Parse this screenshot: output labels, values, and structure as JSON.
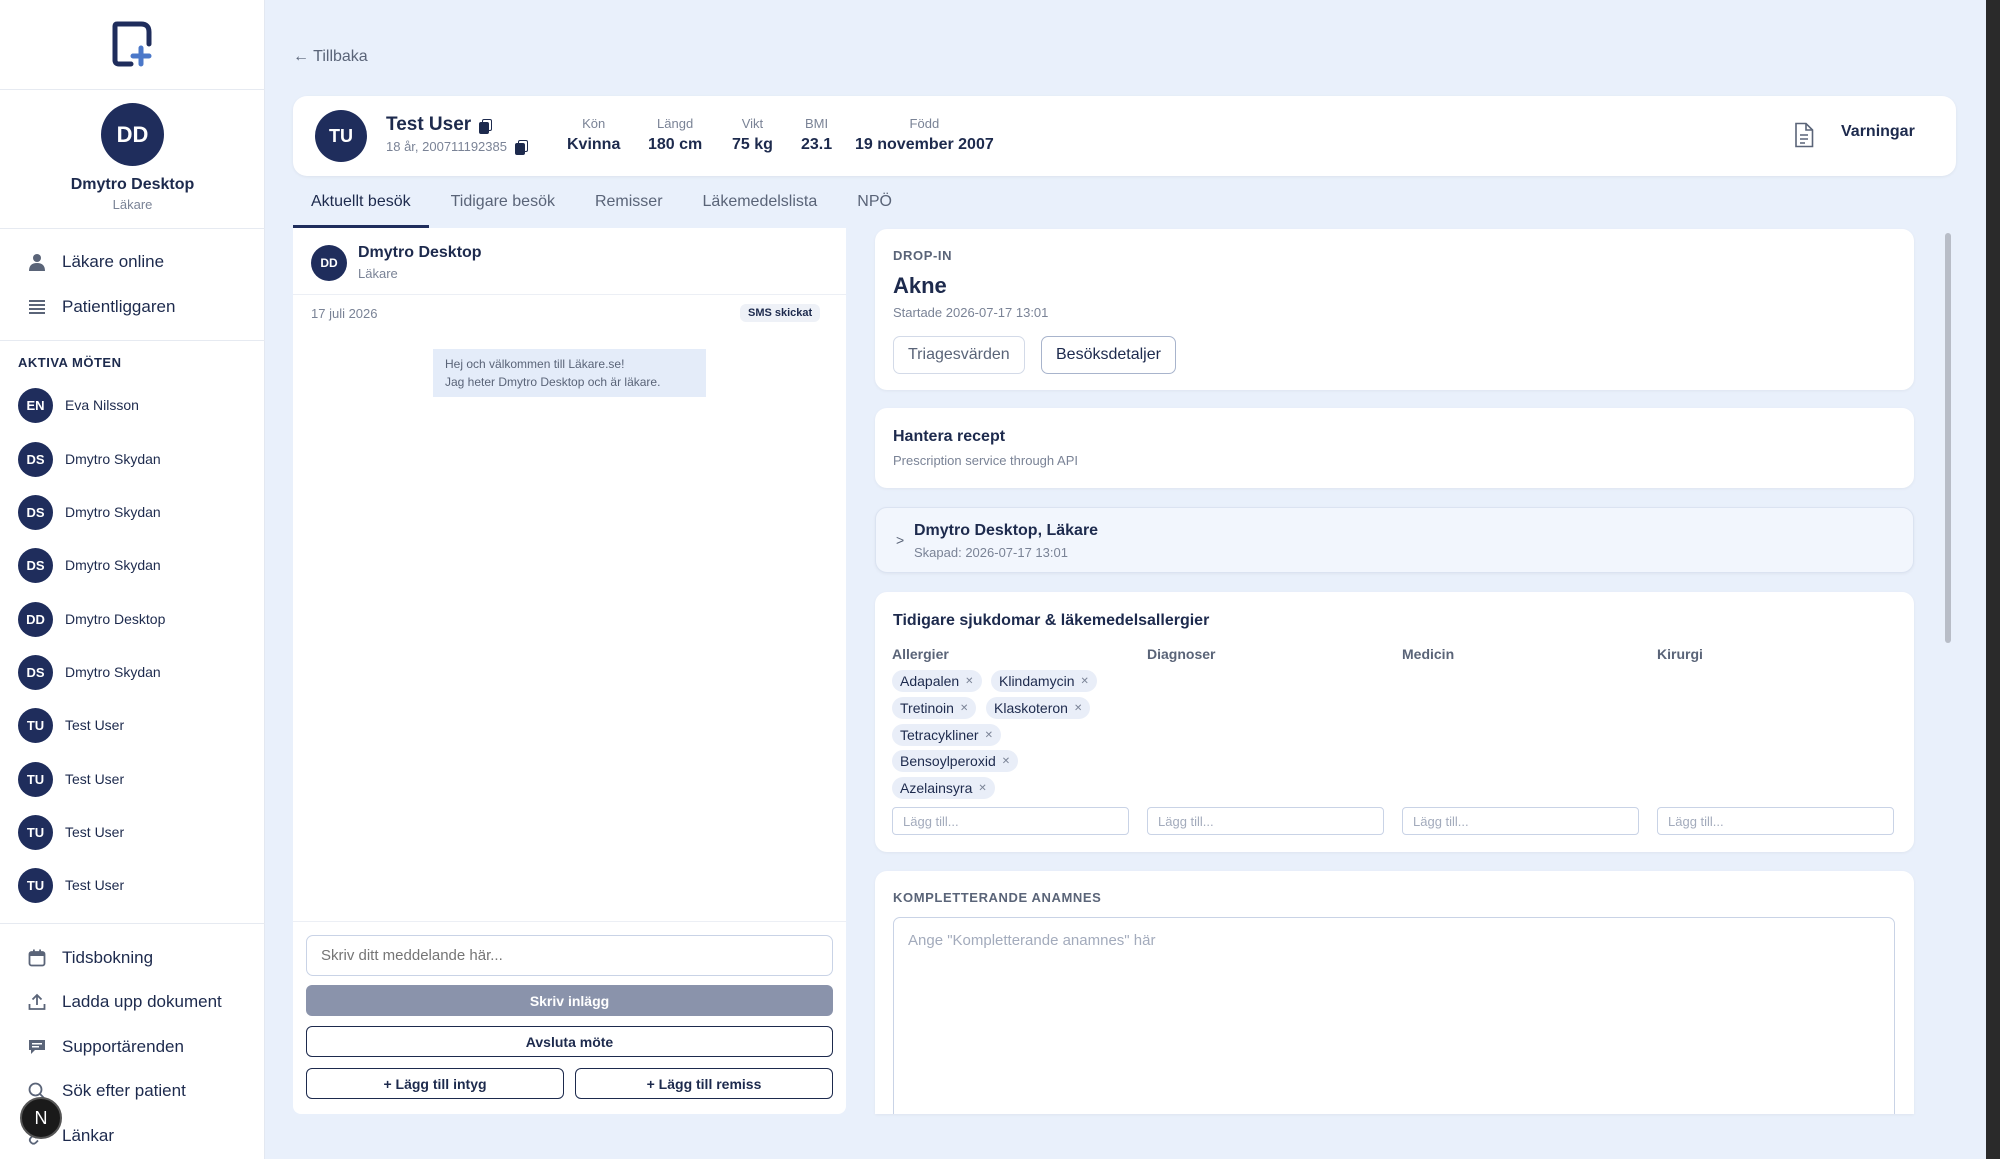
{
  "sidebar": {
    "profile": {
      "initials": "DD",
      "name": "Dmytro Desktop",
      "role": "Läkare"
    },
    "nav_top": [
      {
        "label": "Läkare online",
        "icon": "person-icon"
      },
      {
        "label": "Patientliggaren",
        "icon": "list-icon"
      }
    ],
    "section_label": "AKTIVA MÖTEN",
    "meetings": [
      {
        "initials": "EN",
        "name": "Eva Nilsson"
      },
      {
        "initials": "DS",
        "name": "Dmytro Skydan"
      },
      {
        "initials": "DS",
        "name": "Dmytro Skydan"
      },
      {
        "initials": "DS",
        "name": "Dmytro Skydan"
      },
      {
        "initials": "DD",
        "name": "Dmytro Desktop"
      },
      {
        "initials": "DS",
        "name": "Dmytro Skydan"
      },
      {
        "initials": "TU",
        "name": "Test User"
      },
      {
        "initials": "TU",
        "name": "Test User"
      },
      {
        "initials": "TU",
        "name": "Test User"
      },
      {
        "initials": "TU",
        "name": "Test User"
      }
    ],
    "nav_bottom": [
      {
        "label": "Tidsbokning",
        "icon": "calendar-icon"
      },
      {
        "label": "Ladda upp dokument",
        "icon": "upload-icon"
      },
      {
        "label": "Supportärenden",
        "icon": "chat-icon"
      },
      {
        "label": "Sök efter patient",
        "icon": "search-icon"
      },
      {
        "label": "Länkar",
        "icon": "link-icon"
      }
    ],
    "badge": "N"
  },
  "back_label": "← Tillbaka",
  "patient": {
    "initials": "TU",
    "name": "Test User",
    "sub": "18 år, 200711192385",
    "stats": [
      {
        "label": "Kön",
        "value": "Kvinna"
      },
      {
        "label": "Längd",
        "value": "180 cm"
      },
      {
        "label": "Vikt",
        "value": "75 kg"
      },
      {
        "label": "BMI",
        "value": "23.1"
      },
      {
        "label": "Född",
        "value": "19 november 2007"
      }
    ],
    "warnings_label": "Varningar"
  },
  "tabs": [
    "Aktuellt besök",
    "Tidigare besök",
    "Remisser",
    "Läkemedelslista",
    "NPÖ"
  ],
  "chat": {
    "header": {
      "initials": "DD",
      "name": "Dmytro Desktop",
      "role": "Läkare"
    },
    "date": "17 juli 2026",
    "sms_badge": "SMS skickat",
    "message_line1": "Hej och välkommen till Läkare.se!",
    "message_line2": "Jag heter Dmytro Desktop och är läkare.",
    "input_placeholder": "Skriv ditt meddelande här...",
    "post_button": "Skriv inlägg",
    "end_button": "Avsluta möte",
    "add_cert_button": "+ Lägg till intyg",
    "add_referral_button": "+ Lägg till remiss"
  },
  "visit": {
    "type": "DROP-IN",
    "title": "Akne",
    "started": "Startade 2026-07-17 13:01",
    "btn_triage": "Triagesvärden",
    "btn_details": "Besöksdetaljer"
  },
  "prescription": {
    "title": "Hantera recept",
    "sub": "Prescription service through API"
  },
  "note": {
    "chevron": ">",
    "title": "Dmytro Desktop, Läkare",
    "sub": "Skapad: 2026-07-17 13:01"
  },
  "history": {
    "title": "Tidigare sjukdomar & läkemedelsallergier",
    "columns": [
      "Allergier",
      "Diagnoser",
      "Medicin",
      "Kirurgi"
    ],
    "allergies": [
      "Adapalen",
      "Klindamycin",
      "Tretinoin",
      "Klaskoteron",
      "Tetracykliner",
      "Bensoylperoxid",
      "Azelainsyra"
    ],
    "add_placeholder": "Lägg till..."
  },
  "anamnes": {
    "title": "KOMPLETTERANDE ANAMNES",
    "placeholder": "Ange \"Kompletterande anamnes\" här"
  }
}
